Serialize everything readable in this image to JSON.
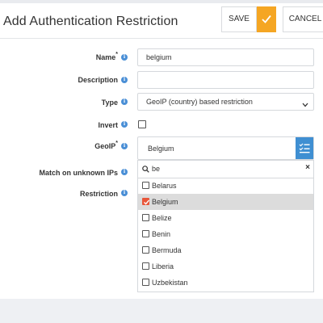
{
  "header": {
    "title": "Add Authentication Restriction",
    "save_label": "SAVE",
    "cancel_label": "CANCEL"
  },
  "form": {
    "name": {
      "label": "Name",
      "required": "*",
      "value": "belgium"
    },
    "description": {
      "label": "Description",
      "value": ""
    },
    "type": {
      "label": "Type",
      "value": "GeoIP (country) based restriction"
    },
    "invert": {
      "label": "Invert",
      "checked": false
    },
    "geoip": {
      "label": "GeoIP",
      "required": "*",
      "selected": "Belgium"
    },
    "match_unknown": {
      "label": "Match on unknown IPs"
    },
    "restriction": {
      "label": "Restriction"
    }
  },
  "dropdown": {
    "search_value": "be",
    "clear": "×",
    "options": [
      {
        "label": "Belarus",
        "checked": false
      },
      {
        "label": "Belgium",
        "checked": true
      },
      {
        "label": "Belize",
        "checked": false
      },
      {
        "label": "Benin",
        "checked": false
      },
      {
        "label": "Bermuda",
        "checked": false
      },
      {
        "label": "Liberia",
        "checked": false
      },
      {
        "label": "Uzbekistan",
        "checked": false
      }
    ]
  },
  "icons": {
    "info": "i",
    "chevron": "⌄"
  },
  "colors": {
    "accent": "#f5a623",
    "primary": "#3f8fd2",
    "checked": "#e8563a",
    "info": "#4a8fd6"
  }
}
